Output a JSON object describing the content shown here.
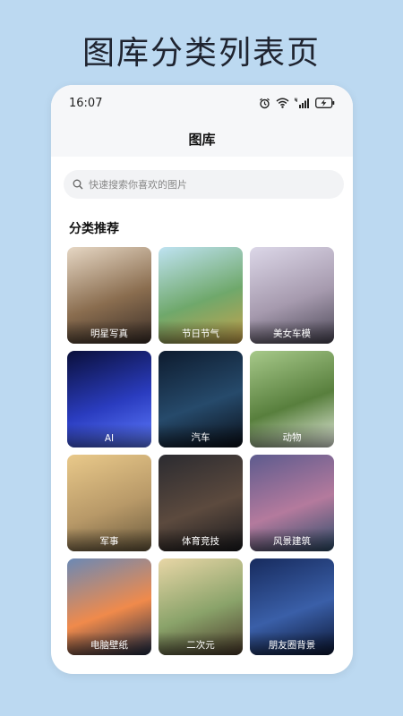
{
  "banner": {
    "title": "图库分类列表页"
  },
  "status_bar": {
    "time": "16:07",
    "icons": [
      "alarm-icon",
      "wifi-icon",
      "signal-4g-icon",
      "battery-charging-icon"
    ]
  },
  "nav": {
    "title": "图库"
  },
  "search": {
    "placeholder": "快速搜索你喜欢的图片",
    "icon": "search-icon"
  },
  "section": {
    "title": "分类推荐"
  },
  "categories": [
    {
      "label": "明星写真",
      "colors": [
        "#e6d7c4",
        "#8a6d4f",
        "#3a2e28"
      ]
    },
    {
      "label": "节日节气",
      "colors": [
        "#bfe3f2",
        "#6fa86b",
        "#c9a24a"
      ]
    },
    {
      "label": "美女车模",
      "colors": [
        "#dcd7e8",
        "#a69aae",
        "#4b4756"
      ]
    },
    {
      "label": "AI",
      "colors": [
        "#0a0f3a",
        "#2a3cbf",
        "#5f7cff"
      ]
    },
    {
      "label": "汽车",
      "colors": [
        "#0d1b2e",
        "#264a6b",
        "#0a0f18"
      ]
    },
    {
      "label": "动物",
      "colors": [
        "#a7c98a",
        "#587f3d",
        "#e9efe2"
      ]
    },
    {
      "label": "军事",
      "colors": [
        "#e9c98a",
        "#b89968",
        "#6a5a3d"
      ]
    },
    {
      "label": "体育竞技",
      "colors": [
        "#2b2b30",
        "#5c4a3e",
        "#1a1a1e"
      ]
    },
    {
      "label": "风景建筑",
      "colors": [
        "#5d5b8e",
        "#b47a9d",
        "#2c4d6b"
      ]
    },
    {
      "label": "电脑壁纸",
      "colors": [
        "#6b89b5",
        "#f08a4b",
        "#1d2a44"
      ]
    },
    {
      "label": "二次元",
      "colors": [
        "#e8d6a6",
        "#8aa36a",
        "#4b3a2a"
      ]
    },
    {
      "label": "朋友圈背景",
      "colors": [
        "#172b5e",
        "#3a5fa8",
        "#0b1633"
      ]
    }
  ]
}
